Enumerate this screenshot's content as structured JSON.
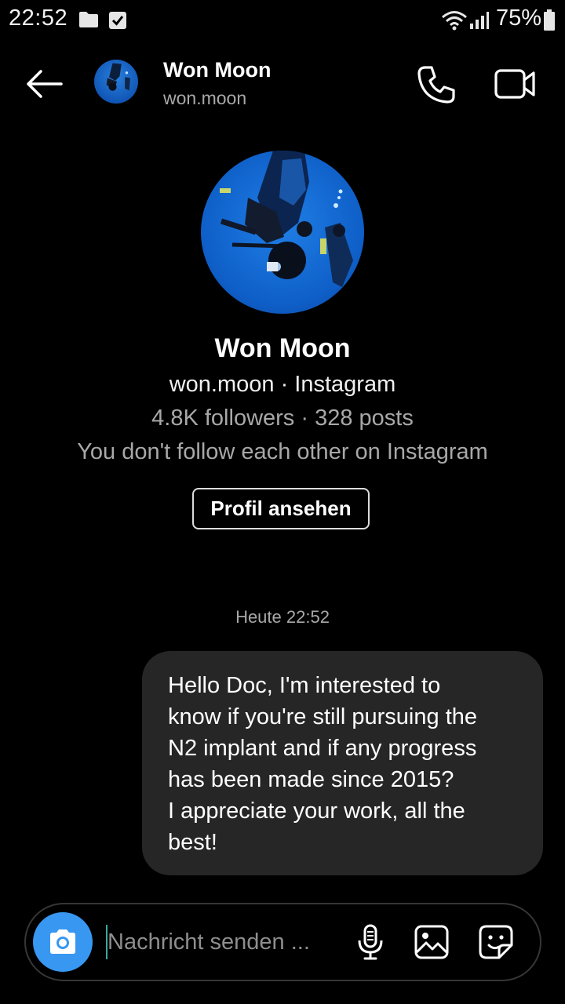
{
  "status_bar": {
    "time": "22:52",
    "battery": "75%",
    "icons": [
      "folder-icon",
      "checkbox-icon",
      "wifi-icon",
      "signal-icon",
      "battery-icon"
    ]
  },
  "header": {
    "back_icon": "arrow-left-icon",
    "name": "Won Moon",
    "username": "won.moon",
    "call_icon": "phone-icon",
    "video_icon": "video-camera-icon"
  },
  "profile": {
    "name": "Won Moon",
    "handle": "won.moon · Instagram",
    "stats": "4.8K followers · 328 posts",
    "relation": "You don't follow each other on Instagram",
    "view_profile_label": "Profil ansehen"
  },
  "thread": {
    "timestamp": "Heute 22:52",
    "messages": [
      {
        "sender": "me",
        "text": "Hello Doc, I'm interested to\nknow if you're still pursuing the\nN2 implant and if any progress\nhas been made since 2015?\nI appreciate your work, all the\nbest!"
      }
    ]
  },
  "composer": {
    "placeholder": "Nachricht senden ...",
    "value": "",
    "camera_icon": "camera-icon",
    "mic_icon": "microphone-icon",
    "gallery_icon": "image-icon",
    "sticker_icon": "sticker-icon"
  },
  "colors": {
    "background": "#000000",
    "bubble": "#262626",
    "camera_button": "#3897f0",
    "muted_text": "#a8a8a8"
  }
}
